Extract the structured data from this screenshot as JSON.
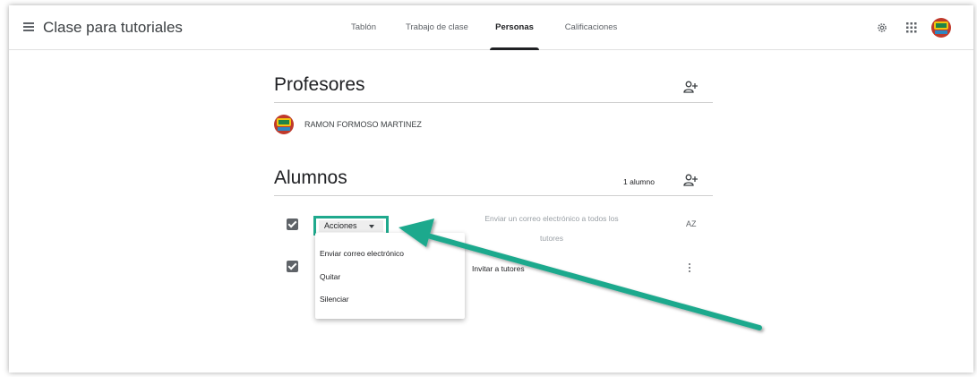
{
  "header": {
    "app_title": "Clase para tutoriales",
    "tabs": [
      {
        "label": "Tablón"
      },
      {
        "label": "Trabajo de clase"
      },
      {
        "label": "Personas"
      },
      {
        "label": "Calificaciones"
      }
    ],
    "active_tab": "Personas"
  },
  "teachers": {
    "title": "Profesores",
    "list": [
      {
        "name": "RAMON FORMOSO MARTINEZ"
      }
    ]
  },
  "students": {
    "title": "Alumnos",
    "count": "1 alumno",
    "actions_label": "Acciones",
    "email_all_line1": "Enviar un correo electrónico a todos los",
    "email_all_line2": "tutores",
    "invite_tutors": "Invitar a tutores",
    "sort_label": "AZ"
  },
  "actions_menu": {
    "items": [
      {
        "label": "Enviar correo electrónico"
      },
      {
        "label": "Quitar"
      },
      {
        "label": "Silenciar"
      }
    ]
  },
  "colors": {
    "highlight": "#1fa98d",
    "text": "#202124",
    "muted": "#5f6368"
  },
  "icons": [
    "menu-icon",
    "gear-icon",
    "apps-icon",
    "avatar",
    "person-add-icon",
    "sort-icon",
    "more-vert-icon",
    "checkbox",
    "caret-down-icon",
    "arrow-annotation"
  ]
}
